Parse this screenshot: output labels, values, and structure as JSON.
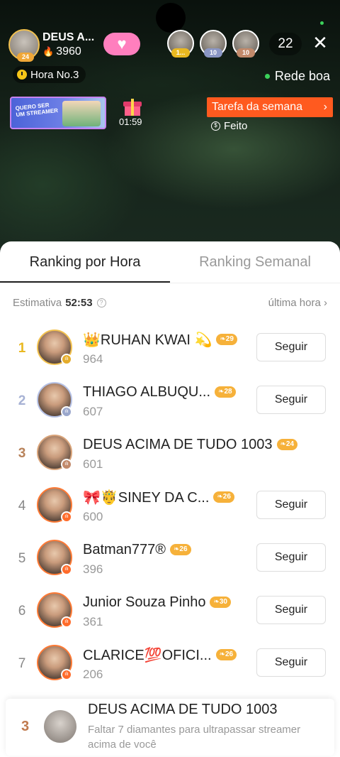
{
  "header": {
    "host_name": "DEUS A...",
    "host_level": "24",
    "host_score": "3960",
    "viewers": [
      {
        "badge": "1...",
        "badge_color": "#e9b820"
      },
      {
        "badge": "10",
        "badge_color": "#8a96c4"
      },
      {
        "badge": "10",
        "badge_color": "#c1896a"
      }
    ],
    "viewer_count": "22",
    "hour_label": "Hora No.3",
    "network_label": "Rede boa",
    "banner_text": "Quero ser um streamer",
    "gift_timer": "01:59",
    "task_label": "Tarefa da semana",
    "done_label": "Feito"
  },
  "ranking": {
    "tabs": [
      "Ranking por Hora",
      "Ranking Semanal"
    ],
    "estimate_label": "Estimativa",
    "estimate_time": "52:53",
    "last_hour": "última hora",
    "follow_label": "Seguir",
    "rows": [
      {
        "rank": "1",
        "name": "👑RUHAN KWAI 💫",
        "level": "29",
        "score": "964"
      },
      {
        "rank": "2",
        "name": "THIAGO ALBUQU...",
        "level": "28",
        "score": "607"
      },
      {
        "rank": "3",
        "name": "DEUS ACIMA DE TUDO 1003",
        "level": "24",
        "score": "601"
      },
      {
        "rank": "4",
        "name": "🎀🤴SINEY DA C...",
        "level": "26",
        "score": "600"
      },
      {
        "rank": "5",
        "name": "Batman777®",
        "level": "26",
        "score": "396"
      },
      {
        "rank": "6",
        "name": "Junior Souza Pinho",
        "level": "30",
        "score": "361"
      },
      {
        "rank": "7",
        "name": "CLARICE💯OFICI...",
        "level": "26",
        "score": "206"
      }
    ]
  },
  "me": {
    "rank": "3",
    "name": "DEUS ACIMA DE TUDO 1003",
    "description": "Faltar 7 diamantes para ultrapassar streamer acima de você"
  },
  "colors": {
    "accent": "#ff5a1f",
    "gold": "#e9b820",
    "level_badge": "#f6b13a"
  }
}
